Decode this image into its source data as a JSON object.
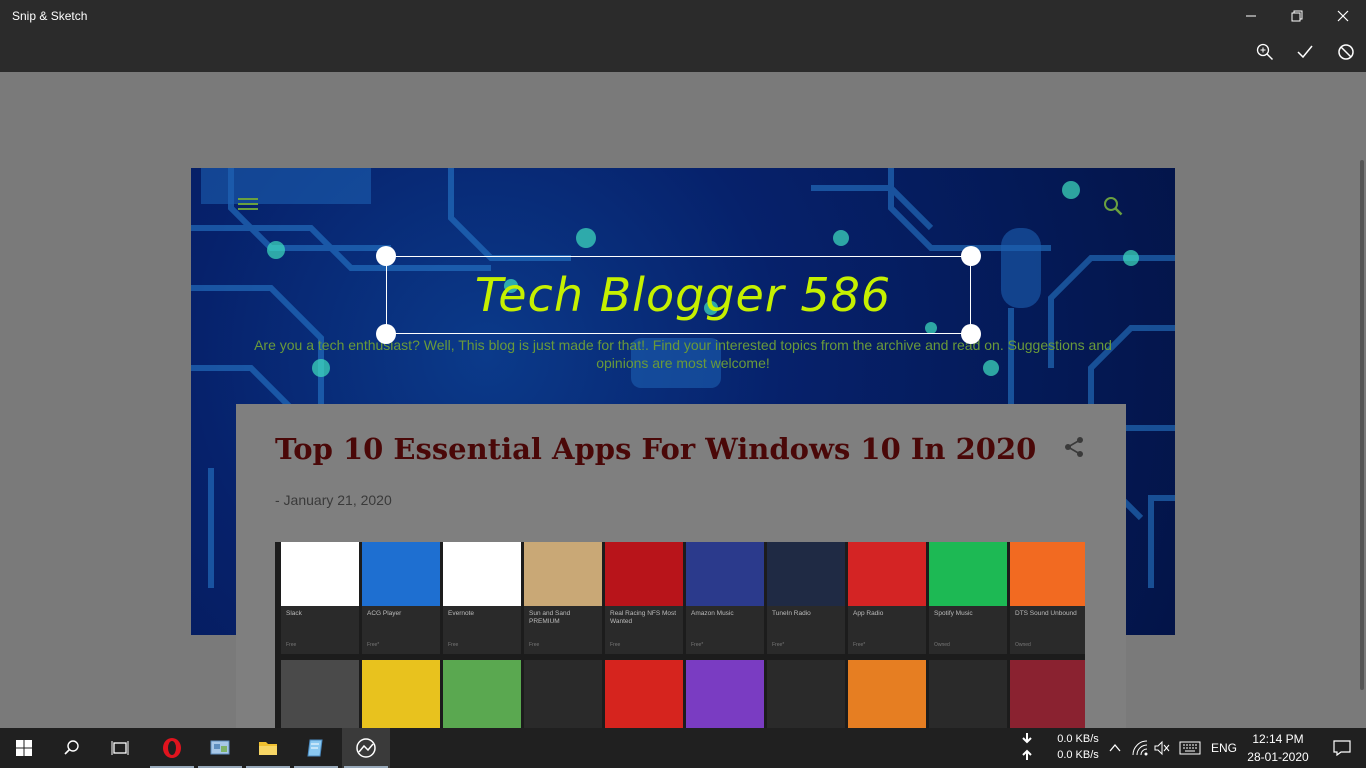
{
  "window": {
    "title": "Snip & Sketch"
  },
  "blog": {
    "title": "Tech Blogger 586",
    "tagline": "Are you a tech enthusiast? Well, This blog is just made for that!. Find your interested topics from the archive and read on. Suggestions and opinions are most welcome!",
    "post": {
      "title": "Top 10 Essential Apps For Windows 10 In 2020",
      "date": "- January 21, 2020"
    },
    "tiles_row1": [
      {
        "name": "Slack",
        "foot": "Free",
        "color": "#ffffff"
      },
      {
        "name": "ACG Player",
        "foot": "Free*",
        "color": "#1e6fd1"
      },
      {
        "name": "Evernote",
        "foot": "Free",
        "color": "#ffffff"
      },
      {
        "name": "Sun and Sand PREMIUM",
        "foot": "Free",
        "color": "#c9a876"
      },
      {
        "name": "Real Racing NFS Most Wanted",
        "foot": "Free",
        "color": "#b8141a"
      },
      {
        "name": "Amazon Music",
        "foot": "Free*",
        "color": "#2b3a8c"
      },
      {
        "name": "TuneIn Radio",
        "foot": "Free*",
        "color": "#1f2a44"
      },
      {
        "name": "App Radio",
        "foot": "Free*",
        "color": "#d42424"
      },
      {
        "name": "Spotify Music",
        "foot": "Owned",
        "color": "#1db954"
      },
      {
        "name": "DTS Sound Unbound",
        "foot": "Owned",
        "color": "#f26a21"
      }
    ],
    "tiles_row2_colors": [
      "#4a4a4a",
      "#e8c21e",
      "#5aa850",
      "#2a2a2a",
      "#d6241e",
      "#7a3cc2",
      "#2a2a2a",
      "#e67e22",
      "#2a2a2a",
      "#8a2230"
    ]
  },
  "taskbar": {
    "net_down": "0.0 KB/s",
    "net_up": "0.0 KB/s",
    "lang": "ENG",
    "time": "12:14 PM",
    "date": "28-01-2020"
  }
}
